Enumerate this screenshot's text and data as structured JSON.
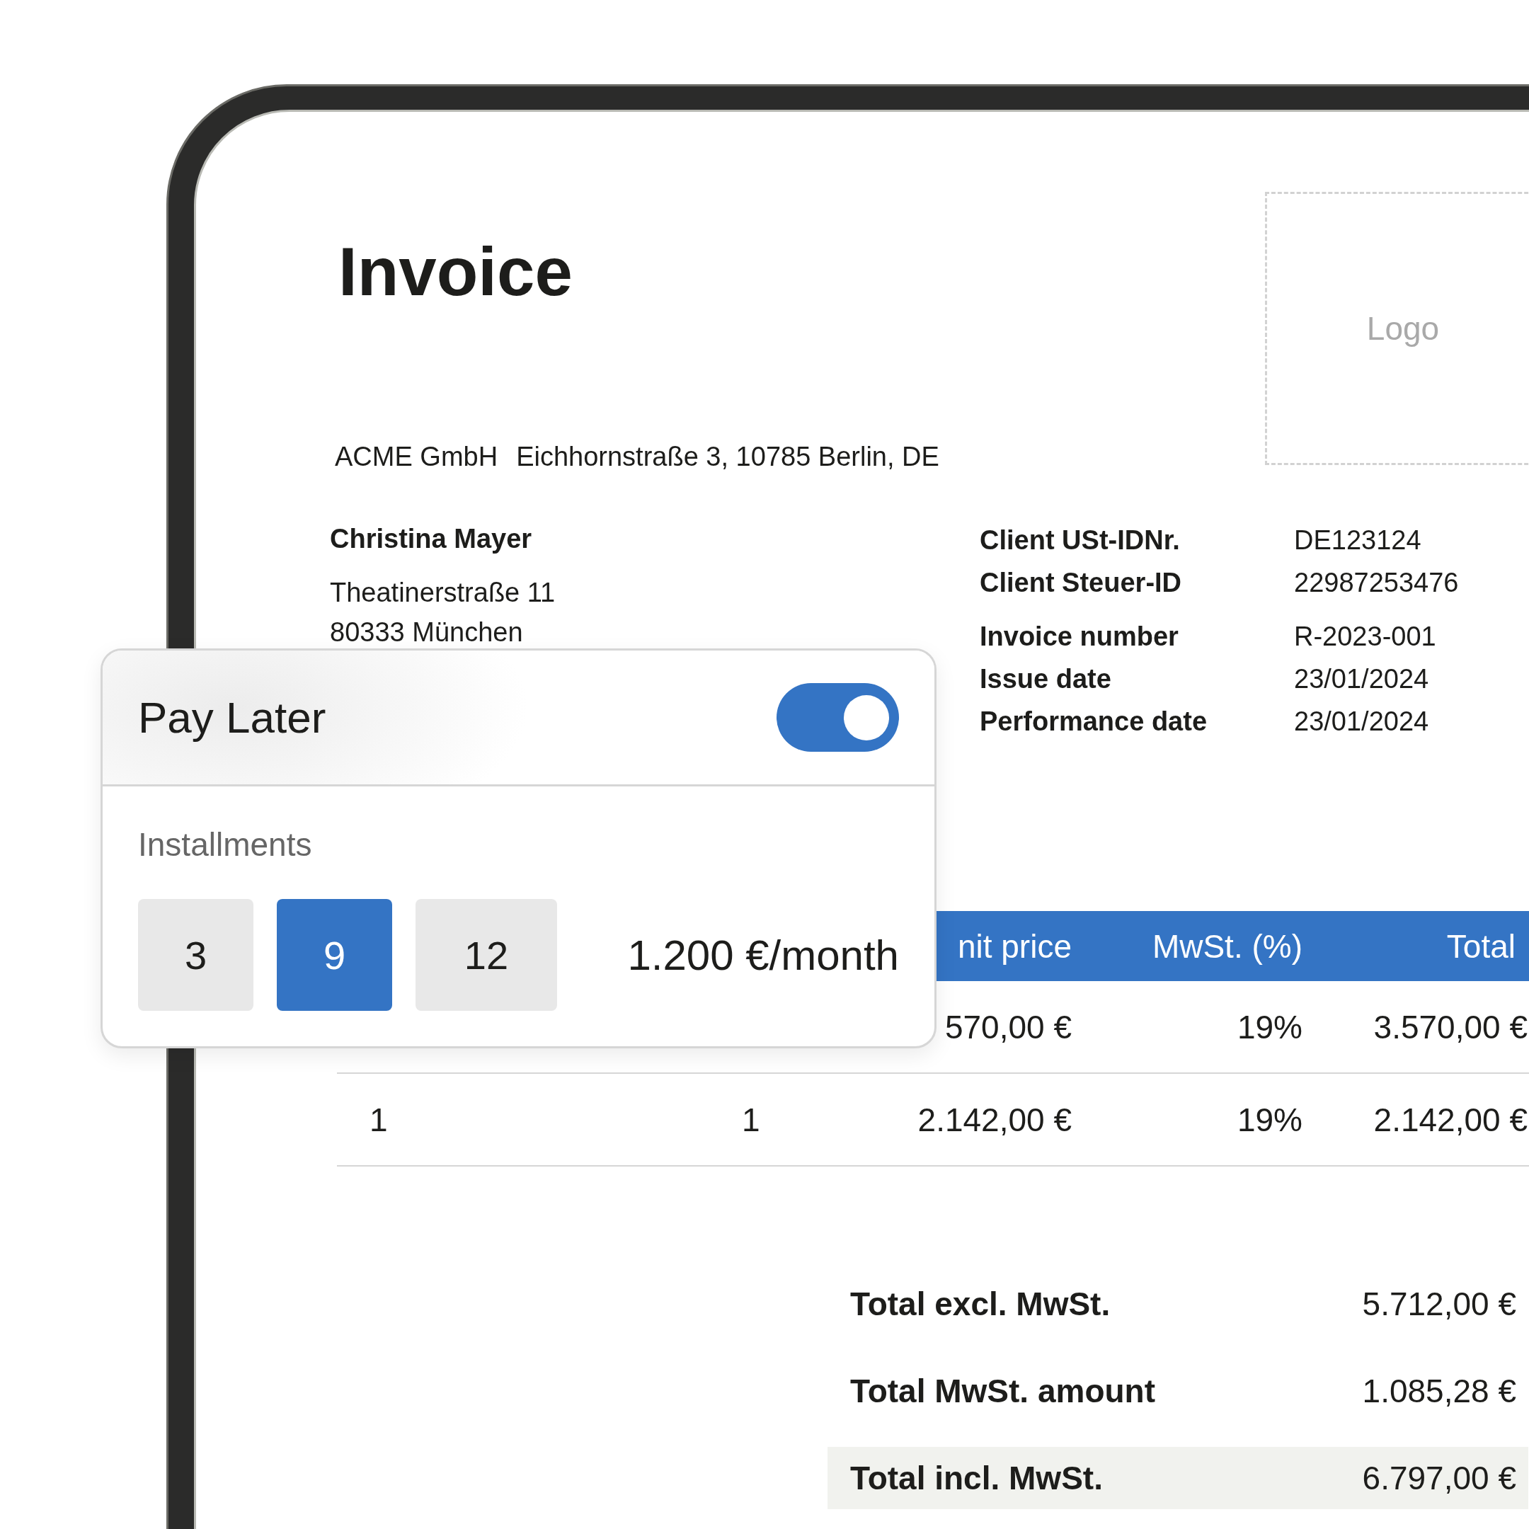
{
  "invoice": {
    "title": "Invoice",
    "logo": "Logo",
    "sender_name": "ACME GmbH",
    "sender_address": "Eichhornstraße 3, 10785 Berlin, DE",
    "client_lines": [
      "Christina Mayer",
      "Theatinerstraße 11",
      "80333 München"
    ],
    "meta_groups": [
      [
        {
          "label": "Client USt-IDNr.",
          "value": "DE123124"
        },
        {
          "label": "Client Steuer-ID",
          "value": "22987253476"
        }
      ],
      [
        {
          "label": "Invoice number",
          "value": "R-2023-001"
        },
        {
          "label": "Issue date",
          "value": "23/01/2024"
        },
        {
          "label": "Performance date",
          "value": "23/01/2024"
        }
      ]
    ],
    "table": {
      "columns": [
        "nit price",
        "MwSt. (%)",
        "Total"
      ],
      "rows": [
        {
          "unit_price": "570,00 €",
          "mwst": "19%",
          "total": "3.570,00 €"
        },
        {
          "column_1": "1",
          "column_2": "1",
          "unit_price": "2.142,00 €",
          "mwst": "19%",
          "total": "2.142,00 €"
        }
      ]
    },
    "totals": [
      {
        "label": "Total excl. MwSt.",
        "value": "5.712,00 €",
        "highlighted": false
      },
      {
        "label": "Total MwSt. amount",
        "value": "1.085,28 €",
        "highlighted": false
      },
      {
        "label": "Total incl. MwSt.",
        "value": "6.797,00 €",
        "highlighted": true
      }
    ]
  },
  "pay_later": {
    "title": "Pay Later",
    "on": true,
    "installments_label": "Installments",
    "options": [
      {
        "label": "3",
        "selected": false
      },
      {
        "label": "9",
        "selected": true
      },
      {
        "label": "12",
        "selected": false
      }
    ],
    "rate": "1.200 €/month"
  }
}
